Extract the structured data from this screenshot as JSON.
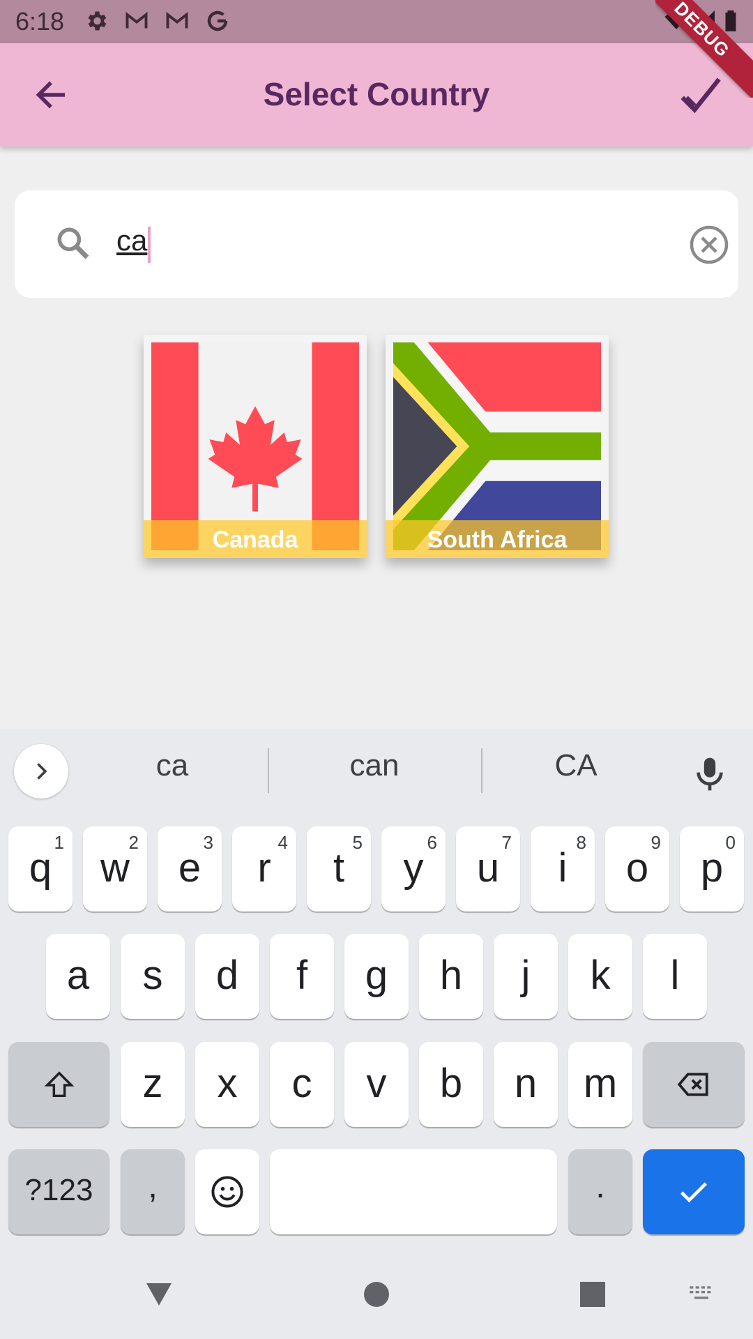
{
  "status_bar": {
    "time": "6:18",
    "icons": [
      "settings-icon",
      "gmail-icon",
      "gmail-icon",
      "google-icon",
      "wifi-icon",
      "signal-icon",
      "battery-icon"
    ],
    "ribbon": "DEBUG"
  },
  "app_bar": {
    "title": "Select Country",
    "back_icon": "arrow-back-icon",
    "confirm_icon": "check-icon",
    "color": "#f0b7d4"
  },
  "search": {
    "value": "ca",
    "search_icon": "search-icon",
    "clear_icon": "clear-circle-icon"
  },
  "results": [
    {
      "name": "Canada",
      "flag": "canada-flag"
    },
    {
      "name": "South Africa",
      "flag": "south-africa-flag"
    }
  ],
  "keyboard": {
    "suggestions": [
      "ca",
      "can",
      "CA"
    ],
    "row1": [
      {
        "k": "q",
        "h": "1"
      },
      {
        "k": "w",
        "h": "2"
      },
      {
        "k": "e",
        "h": "3"
      },
      {
        "k": "r",
        "h": "4"
      },
      {
        "k": "t",
        "h": "5"
      },
      {
        "k": "y",
        "h": "6"
      },
      {
        "k": "u",
        "h": "7"
      },
      {
        "k": "i",
        "h": "8"
      },
      {
        "k": "o",
        "h": "9"
      },
      {
        "k": "p",
        "h": "0"
      }
    ],
    "row2": [
      "a",
      "s",
      "d",
      "f",
      "g",
      "h",
      "j",
      "k",
      "l"
    ],
    "row3": [
      "z",
      "x",
      "c",
      "v",
      "b",
      "n",
      "m"
    ],
    "symbols_label": "?123",
    "comma_label": ",",
    "period_label": ".",
    "enter_color": "#1a73e8"
  },
  "nav_bar": {
    "icons": [
      "back-triangle-icon",
      "home-circle-icon",
      "recents-square-icon",
      "keyboard-switch-icon"
    ]
  }
}
